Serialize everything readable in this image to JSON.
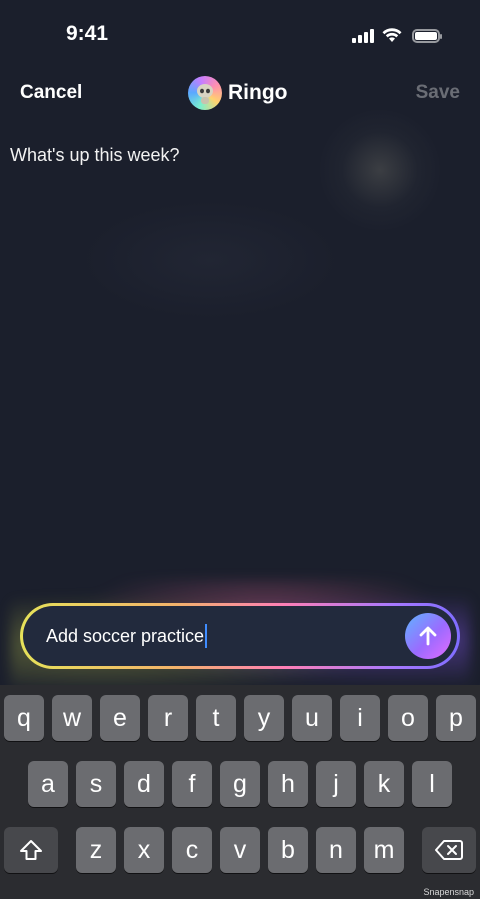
{
  "status_bar": {
    "time": "9:41"
  },
  "nav": {
    "cancel_label": "Cancel",
    "title": "Ringo",
    "save_label": "Save"
  },
  "message": {
    "text": "What's up this week?"
  },
  "composer": {
    "value": "Add soccer practice"
  },
  "keyboard": {
    "row1": [
      "q",
      "w",
      "e",
      "r",
      "t",
      "y",
      "u",
      "i",
      "o",
      "p"
    ],
    "row2": [
      "a",
      "s",
      "d",
      "f",
      "g",
      "h",
      "j",
      "k",
      "l"
    ],
    "row3": [
      "z",
      "x",
      "c",
      "v",
      "b",
      "n",
      "m"
    ]
  },
  "watermark": "Snapensnap",
  "colors": {
    "background": "#1b1f2c",
    "cursor": "#3f8cff",
    "key": "#6b6c70",
    "keyboard_bg": "#2b2c30"
  },
  "icons": [
    "signal-icon",
    "wifi-icon",
    "battery-icon",
    "avatar-icon",
    "send-arrow-icon",
    "shift-icon",
    "backspace-icon"
  ]
}
